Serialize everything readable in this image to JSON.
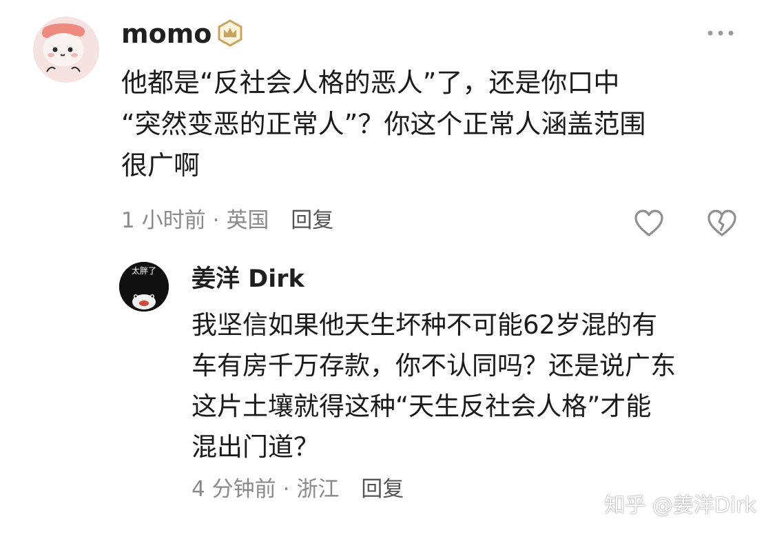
{
  "comment": {
    "username": "momo",
    "badge_icon": "crown-badge-icon",
    "more_icon": "more-dots-icon",
    "text_lines": [
      "他都是“反社会人格的恶人”了，还是你口中",
      "“突然变恶的正常人”？你这个正常人涵盖范围",
      "很广啊"
    ],
    "time": "1 小时前",
    "location": "英国",
    "separator": "·",
    "reply_label": "回复",
    "like_icon": "heart-outline-icon",
    "dislike_icon": "broken-heart-icon"
  },
  "reply": {
    "username": "姜洋 Dirk",
    "avatar_text": "太胖了",
    "text_lines": [
      "我坚信如果他天生坏种不可能62岁混的有",
      "车有房千万存款，你不认同吗？还是说广东",
      "这片土壤就得这种“天生反社会人格”才能",
      "混出门道？"
    ],
    "time": "4 分钟前",
    "location": "浙江",
    "separator": "·",
    "reply_label": "回复"
  },
  "watermark": "知乎 @姜洋Dirk",
  "colors": {
    "text": "#1a1a1a",
    "meta": "#8a8a8a",
    "badge": "#c9a461",
    "avatar_main_bg": "#f6e3e1"
  }
}
